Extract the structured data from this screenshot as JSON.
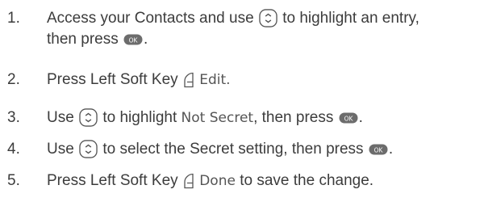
{
  "colors": {
    "text": "#3c3c3c",
    "icon_stroke": "#555555",
    "ok_fill": "#6c6c6c"
  },
  "icons": {
    "navigation": "nav-key-icon",
    "ok": "ok-key-icon",
    "soft_key": "left-soft-key-icon"
  },
  "steps": [
    {
      "number": "1.",
      "line1_a": "Access your Contacts and use",
      "line1_b": "to highlight an entry,",
      "line2_a": "then press",
      "line2_b": "."
    },
    {
      "number": "2.",
      "a": "Press Left Soft Key",
      "ui": "Edit."
    },
    {
      "number": "3.",
      "a": "Use",
      "b": "to highlight",
      "ui": "Not Secret",
      "c": ", then press",
      "d": "."
    },
    {
      "number": "4.",
      "a": "Use",
      "b": "to select the Secret setting, then press",
      "c": "."
    },
    {
      "number": "5.",
      "a": "Press Left Soft Key",
      "ui": "Done",
      "b": "to save the change."
    }
  ],
  "ok_key_label": "OK"
}
